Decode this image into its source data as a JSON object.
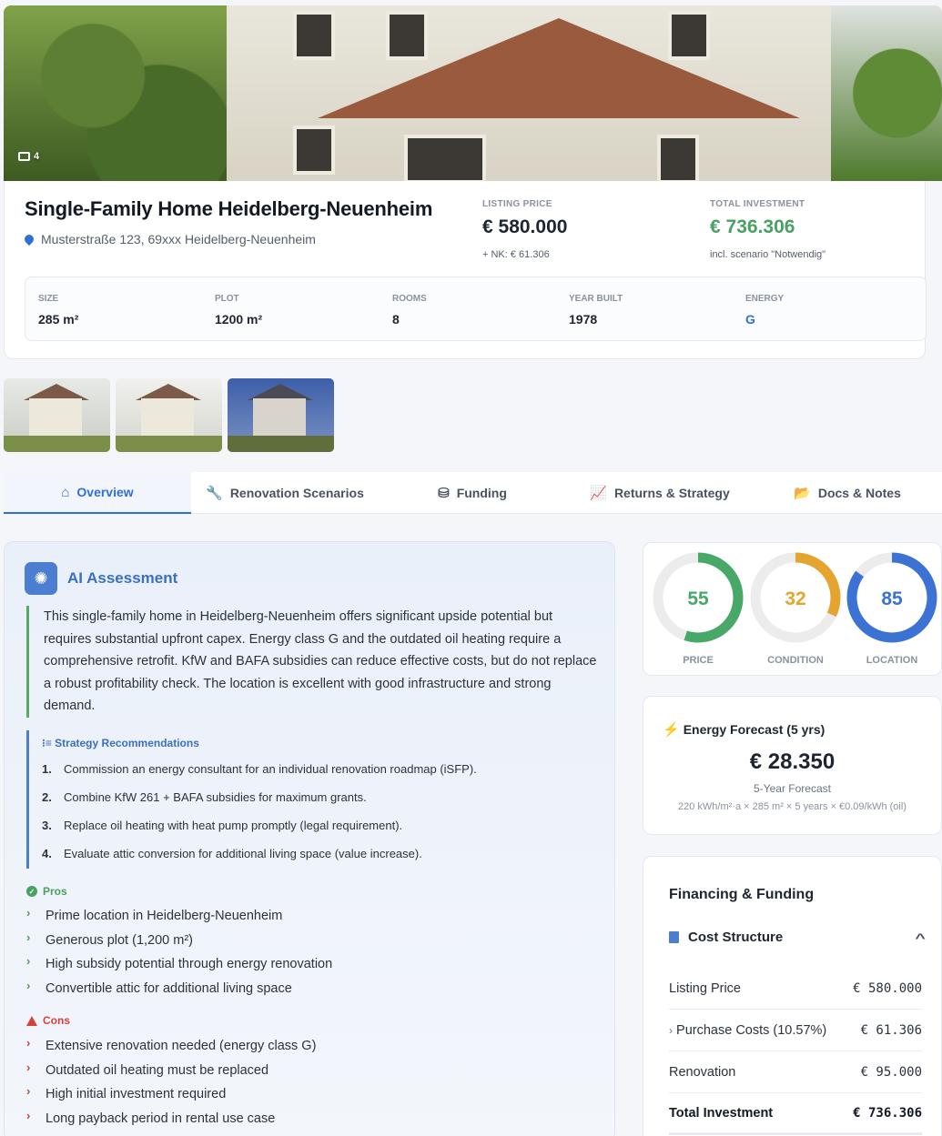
{
  "hero": {
    "photo_count": "4"
  },
  "listing": {
    "title": "Single-Family Home Heidelberg-Neuenheim",
    "address": "Musterstraße 123, 69xxx Heidelberg-Neuenheim",
    "listing_price_label": "LISTING PRICE",
    "listing_price": "€ 580.000",
    "listing_price_sub": "+ NK: € 61.306",
    "total_investment_label": "TOTAL INVESTMENT",
    "total_investment": "€ 736.306",
    "total_investment_sub": "incl. scenario \"Notwendig\"",
    "facts": [
      {
        "label": "SIZE",
        "value": "285 m²"
      },
      {
        "label": "PLOT",
        "value": "1200 m²"
      },
      {
        "label": "ROOMS",
        "value": "8"
      },
      {
        "label": "YEAR BUILT",
        "value": "1978"
      },
      {
        "label": "ENERGY",
        "value": "G"
      }
    ]
  },
  "colors": {
    "accent": "#2f6fd8",
    "green": "#48a061",
    "orange": "#e5a42d",
    "red": "#d2433b"
  },
  "tabs": [
    {
      "label": "Overview",
      "icon": "home-icon"
    },
    {
      "label": "Renovation Scenarios",
      "icon": "wrench-icon"
    },
    {
      "label": "Funding",
      "icon": "coins-icon"
    },
    {
      "label": "Returns & Strategy",
      "icon": "chart-line-icon"
    },
    {
      "label": "Docs & Notes",
      "icon": "folder-icon"
    }
  ],
  "ai": {
    "title": "AI Assessment",
    "text": "This single-family home in Heidelberg-Neuenheim offers significant upside potential but requires substantial upfront capex. Energy class G and the outdated oil heating require a comprehensive retrofit. KfW and BAFA subsidies can reduce effective costs, but do not replace a robust profitability check. The location is excellent with good infrastructure and strong demand.",
    "strategy_title": "Strategy Recommendations",
    "strategy": [
      "Commission an energy consultant for an individual renovation roadmap (iSFP).",
      "Combine KfW 261 + BAFA subsidies for maximum grants.",
      "Replace oil heating with heat pump promptly (legal requirement).",
      "Evaluate attic conversion for additional living space (value increase)."
    ],
    "pros_title": "Pros",
    "pros": [
      "Prime location in Heidelberg-Neuenheim",
      "Generous plot (1,200 m²)",
      "High subsidy potential through energy renovation",
      "Convertible attic for additional living space"
    ],
    "cons_title": "Cons",
    "cons": [
      "Extensive renovation needed (energy class G)",
      "Outdated oil heating must be replaced",
      "High initial investment required",
      "Long payback period in rental use case"
    ]
  },
  "scores": [
    {
      "label": "PRICE",
      "value": 55,
      "text": "55",
      "color": "#48a868"
    },
    {
      "label": "CONDITION",
      "value": 32,
      "text": "32",
      "color": "#e5a42d"
    },
    {
      "label": "LOCATION",
      "value": 85,
      "text": "85",
      "color": "#3b72d4"
    }
  ],
  "energy": {
    "title": "Energy Forecast (5 yrs)",
    "value": "€ 28.350",
    "sub": "5-Year Forecast",
    "formula": "220 kWh/m²·a × 285 m² × 5 years × €0.09/kWh (oil)"
  },
  "financing": {
    "title": "Financing & Funding",
    "cost_title": "Cost Structure",
    "rows": [
      {
        "label": "Listing Price",
        "value": "€ 580.000"
      },
      {
        "label": "Purchase Costs (10.57%)",
        "value": "€ 61.306"
      },
      {
        "label": "Renovation",
        "value": "€ 95.000"
      },
      {
        "label": "Total Investment",
        "value": "€ 736.306"
      }
    ]
  }
}
